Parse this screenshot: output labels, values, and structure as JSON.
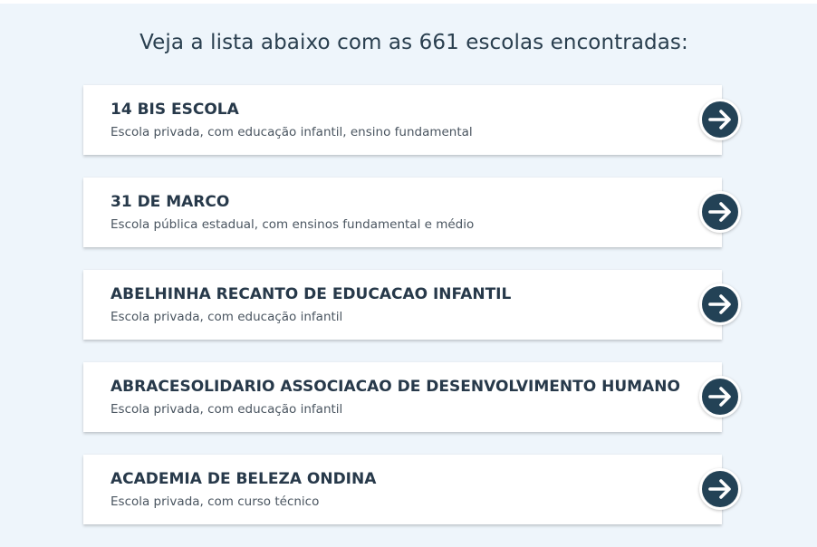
{
  "heading": "Veja a lista abaixo com as 661 escolas encontradas:",
  "results": [
    {
      "name": "14 BIS ESCOLA",
      "description": "Escola privada, com educação infantil, ensino fundamental"
    },
    {
      "name": "31 DE MARCO",
      "description": "Escola pública estadual, com ensinos fundamental e médio"
    },
    {
      "name": "ABELHINHA RECANTO DE EDUCACAO INFANTIL",
      "description": "Escola privada, com educação infantil"
    },
    {
      "name": "ABRACESOLIDARIO ASSOCIACAO DE DESENVOLVIMENTO HUMANO",
      "description": "Escola privada, com educação infantil"
    },
    {
      "name": "ACADEMIA DE BELEZA ONDINA",
      "description": "Escola privada, com curso técnico"
    }
  ],
  "icons": {
    "open": "arrow-right-icon"
  },
  "colors": {
    "background": "#eef5fb",
    "title": "#27394a",
    "button": "#234256"
  }
}
